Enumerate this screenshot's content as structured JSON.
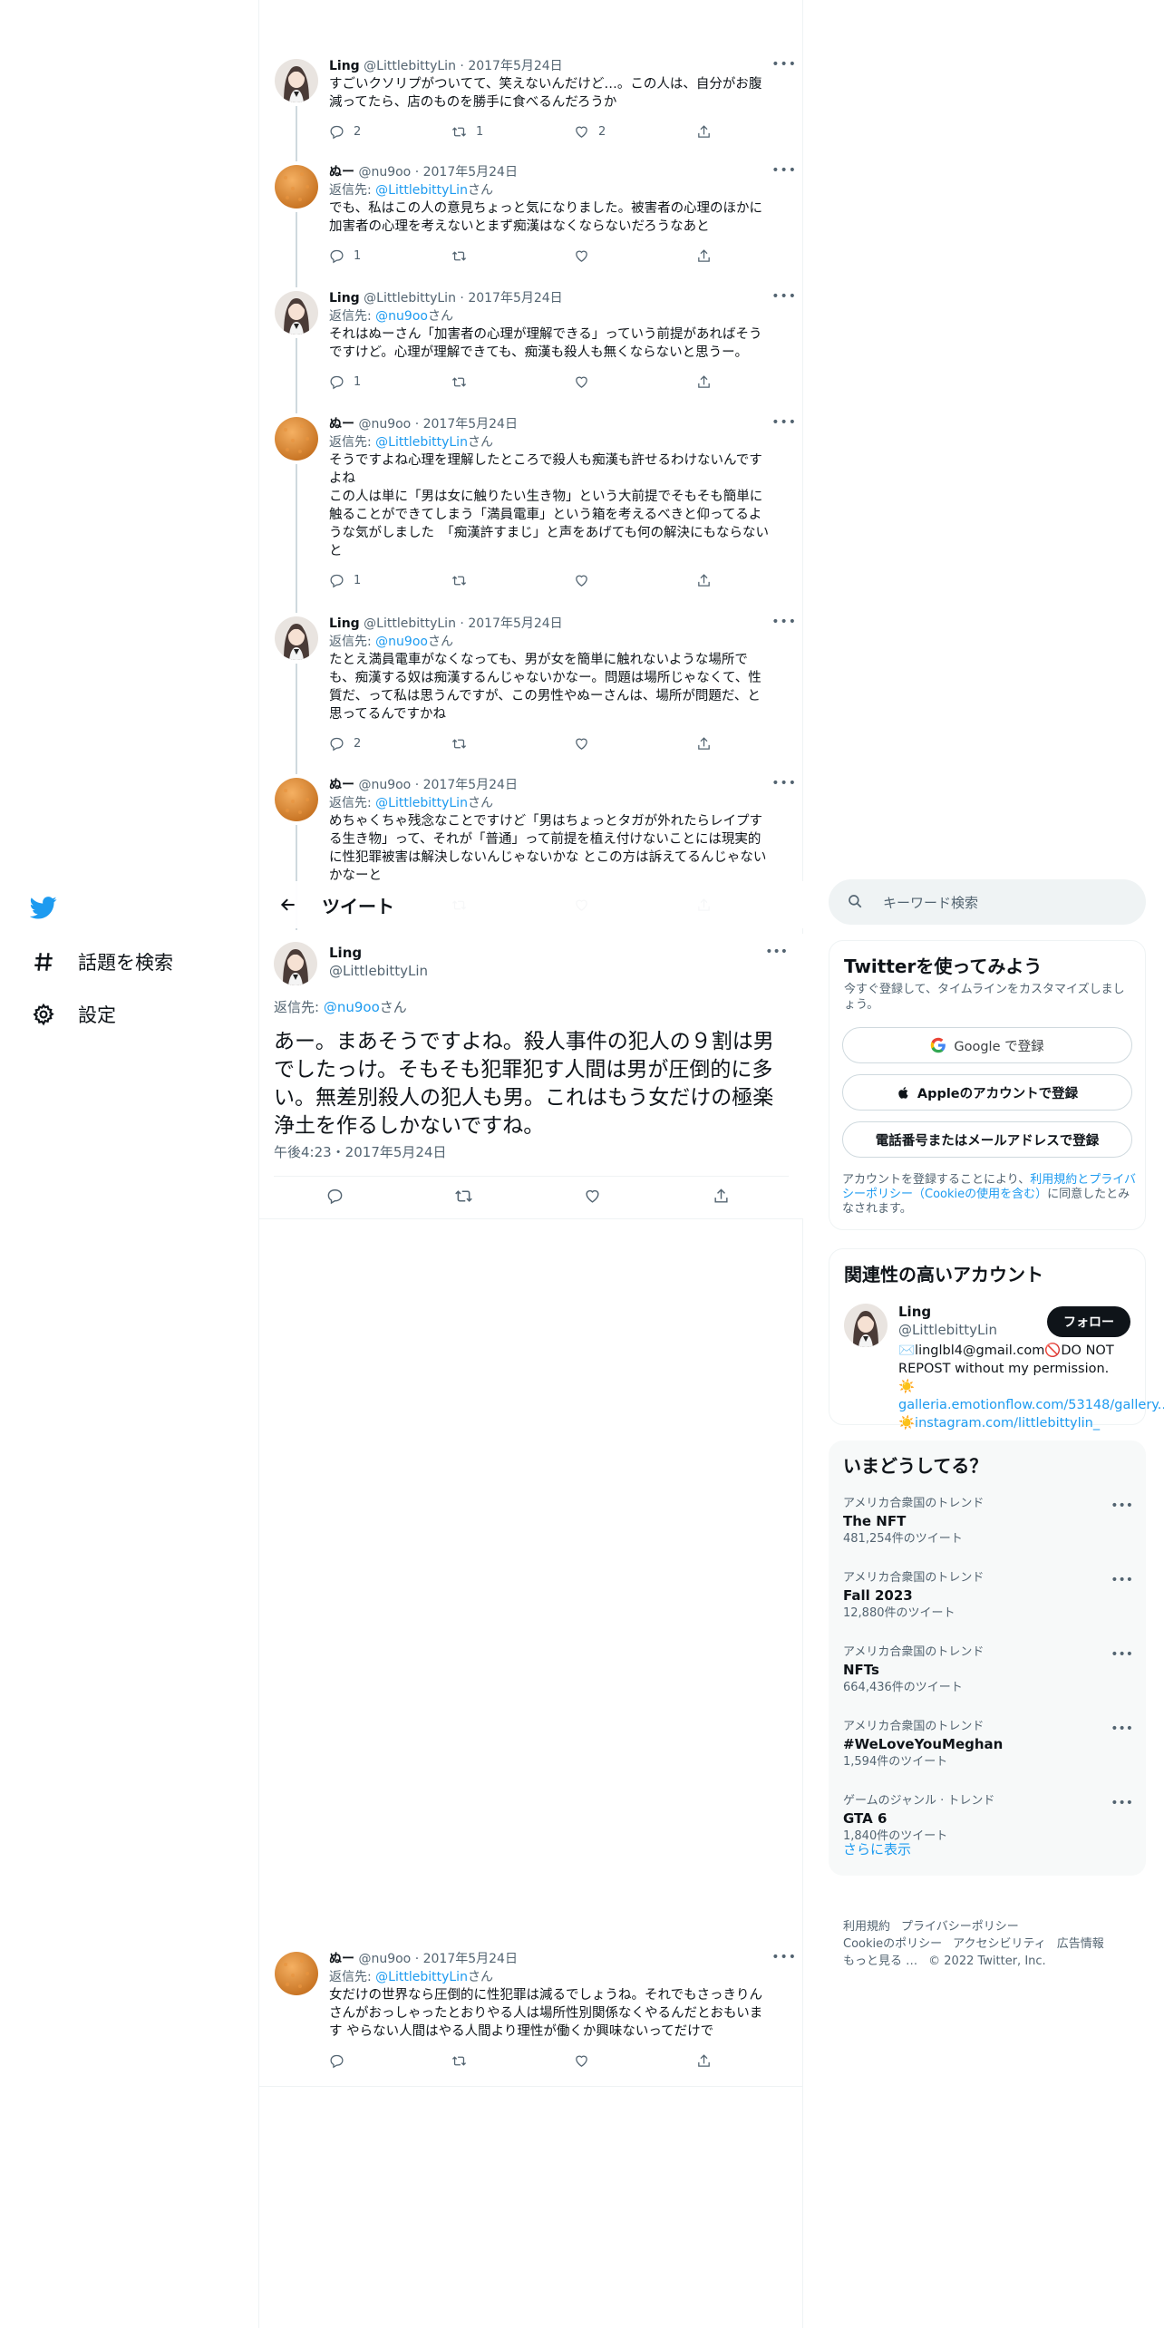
{
  "nav": {
    "explore_label": "話題を検索",
    "settings_label": "設定"
  },
  "thread": [
    {
      "name": "Ling",
      "handle": "@LittlebittyLin",
      "date": "2017年5月24日",
      "avatar": "ling",
      "reply_prefix": "",
      "reply_to": "",
      "reply_suffix": "",
      "text": "すごいクソリプがついてて、笑えないんだけど…。この人は、自分がお腹\n減ってたら、店のものを勝手に食べるんだろうか",
      "replies": "2",
      "retweets": "1",
      "likes": "2"
    },
    {
      "name": "ぬー",
      "handle": "@nu9oo",
      "date": "2017年5月24日",
      "avatar": "nu",
      "reply_prefix": "返信先: ",
      "reply_to": "@LittlebittyLin",
      "reply_suffix": "さん",
      "text": "でも、私はこの人の意見ちょっと気になりました。被害者の心理のほかに\n加害者の心理を考えないとまず痴漢はなくならないだろうなあと",
      "replies": "1",
      "retweets": "",
      "likes": ""
    },
    {
      "name": "Ling",
      "handle": "@LittlebittyLin",
      "date": "2017年5月24日",
      "avatar": "ling",
      "reply_prefix": "返信先: ",
      "reply_to": "@nu9oo",
      "reply_suffix": "さん",
      "text": "それはぬーさん「加害者の心理が理解できる」っていう前提があればそう\nですけど。心理が理解できても、痴漢も殺人も無くならないと思うー。",
      "replies": "1",
      "retweets": "",
      "likes": ""
    },
    {
      "name": "ぬー",
      "handle": "@nu9oo",
      "date": "2017年5月24日",
      "avatar": "nu",
      "reply_prefix": "返信先: ",
      "reply_to": "@LittlebittyLin",
      "reply_suffix": "さん",
      "text": "そうですよね心理を理解したところで殺人も痴漢も許せるわけないんです\nよね\nこの人は単に「男は女に触りたい生き物」という大前提でそもそも簡単に\n触ることができてしまう「満員電車」という箱を考えるべきと仰ってるよ\nうな気がしました　「痴漢許すまじ」と声をあげても何の解決にもならない\nと",
      "replies": "1",
      "retweets": "",
      "likes": ""
    },
    {
      "name": "Ling",
      "handle": "@LittlebittyLin",
      "date": "2017年5月24日",
      "avatar": "ling",
      "reply_prefix": "返信先: ",
      "reply_to": "@nu9oo",
      "reply_suffix": "さん",
      "text": "たとえ満員電車がなくなっても、男が女を簡単に触れないような場所で\nも、痴漢する奴は痴漢するんじゃないかなー。問題は場所じゃなくて、性\n質だ、って私は思うんですが、この男性やぬーさんは、場所が問題だ、と\n思ってるんですかね",
      "replies": "2",
      "retweets": "",
      "likes": ""
    },
    {
      "name": "ぬー",
      "handle": "@nu9oo",
      "date": "2017年5月24日",
      "avatar": "nu",
      "reply_prefix": "返信先: ",
      "reply_to": "@LittlebittyLin",
      "reply_suffix": "さん",
      "text": "めちゃくちゃ残念なことですけど「男はちょっとタガが外れたらレイプす\nる生き物」って、それが「普通」って前提を植え付けないことには現実的\nに性犯罪被害は解決しないんじゃないかな とこの方は訴えてるんじゃない\nかなーと",
      "replies": "",
      "retweets": "",
      "likes": ""
    }
  ],
  "topbar": {
    "title": "ツイート"
  },
  "main_tweet": {
    "name": "Ling",
    "handle": "@LittlebittyLin",
    "reply_prefix": "返信先: ",
    "reply_to": "@nu9oo",
    "reply_suffix": "さん",
    "text": "あー。まあそうですよね。殺人事件の犯人の９割は男でしたっけ。そもそも犯罪犯す人間は男が圧倒的に多い。無差別殺人の犯人も男。これはもう女だけの極楽浄土を作るしかないですね。",
    "timestamp": "午後4:23・2017年5月24日"
  },
  "bottom_reply": {
    "name": "ぬー",
    "handle": "@nu9oo",
    "date": "2017年5月24日",
    "reply_prefix": "返信先: ",
    "reply_to": "@LittlebittyLin",
    "reply_suffix": "さん",
    "text": "女だけの世界なら圧倒的に性犯罪は減るでしょうね。それでもさっきりん\nさんがおっしゃったとおりやる人は場所性別関係なくやるんだとおもいま\nす やらない人間はやる人間より理性が働くか興味ないってだけで"
  },
  "search": {
    "placeholder": "キーワード検索"
  },
  "signup": {
    "title": "Twitterを使ってみよう",
    "desc": "今すぐ登録して、タイムラインをカスタマイズしましょう。",
    "google": "Google で登録",
    "apple": "Appleのアカウントで登録",
    "phone": "電話番号またはメールアドレスで登録",
    "legal_prefix": "アカウントを登録することにより、",
    "legal_link": "利用規約とプライバシーポリシー（Cookieの使用を含む）",
    "legal_suffix": "に同意したとみなされます。"
  },
  "related": {
    "title": "関連性の高いアカウント",
    "name": "Ling",
    "handle": "@LittlebittyLin",
    "follow": "フォロー",
    "bio_text": "✉️linglbl4@gmail.com🚫DO NOT REPOST without my permission. ☀️",
    "bio_link1": "galleria.emotionflow.com/53148/gallery.…",
    "bio_link2": " ☀️instagram.com/littlebittylin_"
  },
  "trends": {
    "title": "いまどうしてる？",
    "items": [
      {
        "category": "アメリカ合衆国のトレンド",
        "name": "The NFT",
        "count": "481,254件のツイート"
      },
      {
        "category": "アメリカ合衆国のトレンド",
        "name": "Fall 2023",
        "count": "12,880件のツイート"
      },
      {
        "category": "アメリカ合衆国のトレンド",
        "name": "NFTs",
        "count": "664,436件のツイート"
      },
      {
        "category": "アメリカ合衆国のトレンド",
        "name": "#WeLoveYouMeghan",
        "count": "1,594件のツイート"
      },
      {
        "category": "ゲームのジャンル · トレンド",
        "name": "GTA 6",
        "count": "1,840件のツイート"
      }
    ],
    "show_more": "さらに表示"
  },
  "footer": {
    "terms": "利用規約",
    "privacy": "プライバシーポリシー",
    "cookie": "Cookieのポリシー",
    "accessibility": "アクセシビリティ",
    "ads": "広告情報",
    "more": "もっと見る …",
    "copyright": "© 2022 Twitter, Inc."
  },
  "colors": {
    "accent": "#1d9bf0",
    "text": "#0f1419",
    "secondary": "#536471",
    "border": "#eff3f4"
  },
  "icons": [
    "twitter-logo-icon",
    "hashtag-icon",
    "gear-icon",
    "back-arrow-icon",
    "search-icon",
    "google-icon",
    "apple-icon",
    "reply-icon",
    "retweet-icon",
    "like-icon",
    "share-icon",
    "more-icon"
  ]
}
